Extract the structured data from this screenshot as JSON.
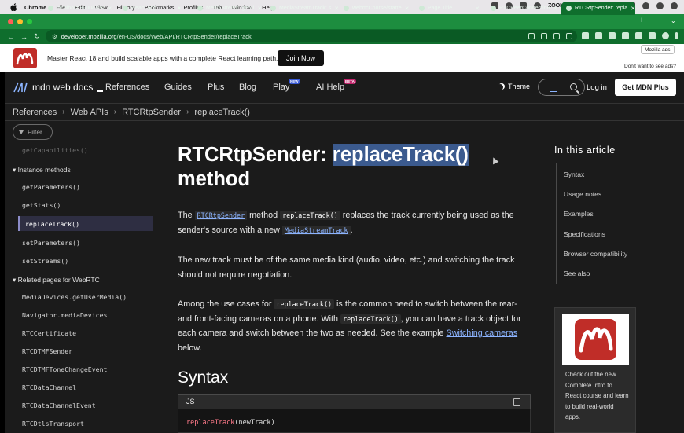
{
  "menubar": {
    "app": "Chrome",
    "items": [
      "File",
      "Edit",
      "View",
      "History",
      "Bookmarks",
      "Profiles",
      "Tab",
      "Window",
      "Help"
    ],
    "zoom_label": "ZOOM"
  },
  "tabs": [
    {
      "label": "localhost:9000/user",
      "active": false
    },
    {
      "label": "React App",
      "active": false
    },
    {
      "label": "MediaStream: getVi",
      "active": false
    },
    {
      "label": "MediaStreamTrack: s",
      "active": false
    },
    {
      "label": "webrtcCourse/starte",
      "active": false
    },
    {
      "label": "Page Title",
      "active": false
    },
    {
      "label": "RTCPeerConnection",
      "active": false
    },
    {
      "label": "RTCRtpSender: repla",
      "active": true
    }
  ],
  "address": {
    "host": "developer.mozilla.org",
    "path": "/en-US/docs/Web/API/RTCRtpSender/replaceTrack"
  },
  "ad": {
    "text": "Master React 18 and build scalable apps with a complete React learning path.",
    "button": "Join Now",
    "mozilla_ads": "Mozilla ads",
    "why": "Don't want to see ads?"
  },
  "mdn": {
    "logo_text": "mdn web docs",
    "nav": [
      "References",
      "Guides",
      "Plus",
      "Blog",
      "Play",
      "AI Help"
    ],
    "badge_new": "NEW",
    "badge_beta": "BETA",
    "theme": "Theme",
    "login": "Log in",
    "plus_button": "Get MDN Plus"
  },
  "breadcrumbs": [
    "References",
    "Web APIs",
    "RTCRtpSender",
    "replaceTrack()"
  ],
  "sidebar": {
    "filter": "Filter",
    "cut_item": "getCapabilities()",
    "instance_heading": "Instance methods",
    "instance_methods": [
      "getParameters()",
      "getStats()",
      "replaceTrack()",
      "setParameters()",
      "setStreams()"
    ],
    "related_heading": "Related pages for WebRTC",
    "related": [
      "MediaDevices.getUserMedia()",
      "Navigator.mediaDevices",
      "RTCCertificate",
      "RTCDTMFSender",
      "RTCDTMFToneChangeEvent",
      "RTCDataChannel",
      "RTCDataChannelEvent",
      "RTCDtlsTransport"
    ]
  },
  "article": {
    "title_prefix": "RTCRtpSender: ",
    "title_selected": "replaceTrack()",
    "title_suffix": "method",
    "p1_a": "The ",
    "p1_link1": "RTCRtpSender",
    "p1_b": " method ",
    "p1_code": "replaceTrack()",
    "p1_c": " replaces the track currently being used as the sender's source with a new ",
    "p1_link2": "MediaStreamTrack",
    "p1_d": ".",
    "p2": "The new track must be of the same media kind (audio, video, etc.) and switching the track should not require negotiation.",
    "p3_a": "Among the use cases for ",
    "p3_code1": "replaceTrack()",
    "p3_b": " is the common need to switch between the rear- and front-facing cameras on a phone. With ",
    "p3_code2": "replaceTrack()",
    "p3_c": ", you can have a track object for each camera and switch between the two as needed. See the example ",
    "p3_link": "Switching cameras",
    "p3_d": " below.",
    "h2": "Syntax",
    "code_lang": "JS",
    "code_fn": "replaceTrack",
    "code_args": "(newTrack)"
  },
  "toc": {
    "title": "In this article",
    "items": [
      "Syntax",
      "Usage notes",
      "Examples",
      "Specifications",
      "Browser compatibility",
      "See also"
    ]
  },
  "sidead": {
    "text": "Check out the new Complete Intro to React course and learn to build real-world apps."
  },
  "colors": {
    "tabstrip": "#1d8d3f",
    "accent_link": "#8cb4ff",
    "page_bg": "#1b1b1b"
  }
}
